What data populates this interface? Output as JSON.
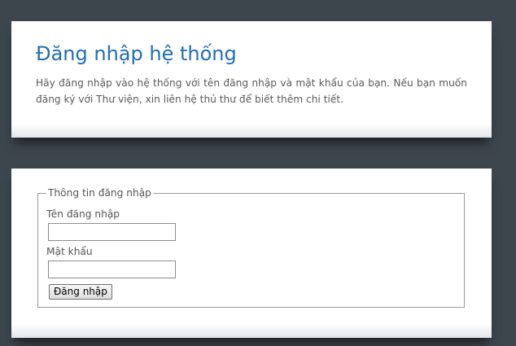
{
  "intro": {
    "title": "Đăng nhập hệ thống",
    "description": "Hãy đăng nhập vào hệ thống với tên đăng nhập và mật khẩu của bạn. Nếu bạn muốn đăng ký với Thư viện, xin liên hệ thủ thư để biết thêm chi tiết."
  },
  "login_form": {
    "legend": "Thông tin đăng nhập",
    "username_label": "Tên đăng nhập",
    "username_value": "",
    "password_label": "Mật khẩu",
    "password_value": "",
    "submit_label": "Đăng nhập"
  },
  "colors": {
    "background": "#3d454d",
    "panel": "#ffffff",
    "title": "#1f6eb5",
    "text": "#5a5a5a"
  }
}
